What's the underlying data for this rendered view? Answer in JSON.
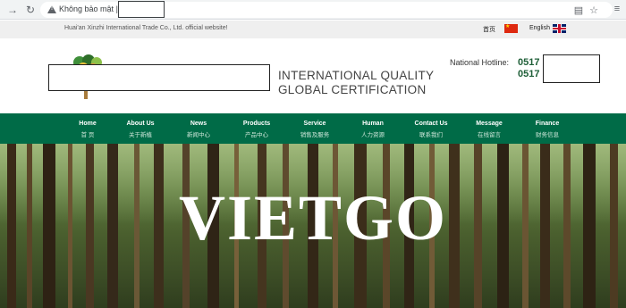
{
  "browser": {
    "security_label": "Không bảo mật",
    "separator": "|"
  },
  "topbar": {
    "welcome": "Huai'an Xinzhi International Trade Co., Ltd. official website!",
    "lang_cn": "首页",
    "lang_en": "English"
  },
  "header": {
    "slogan_line1": "INTERNATIONAL QUALITY",
    "slogan_line2": "GLOBAL CERTIFICATION",
    "hotline_label": "National Hotline:",
    "hotline_1": "0517",
    "hotline_2": "0517"
  },
  "nav": {
    "items": [
      {
        "en": "Home",
        "cn": "首 页"
      },
      {
        "en": "About Us",
        "cn": "关于新植"
      },
      {
        "en": "News",
        "cn": "新闻中心"
      },
      {
        "en": "Products",
        "cn": "产品中心"
      },
      {
        "en": "Service",
        "cn": "销售及服务"
      },
      {
        "en": "Human",
        "cn": "人力资源"
      },
      {
        "en": "Contact Us",
        "cn": "联系我们"
      },
      {
        "en": "Message",
        "cn": "在线留言"
      },
      {
        "en": "Finance",
        "cn": "财务信息"
      }
    ]
  },
  "banner": {
    "title": "VIETGO"
  },
  "colors": {
    "nav_green": "#006b47",
    "hotline_green": "#1f5f38",
    "topbar_gray": "#efefef"
  }
}
